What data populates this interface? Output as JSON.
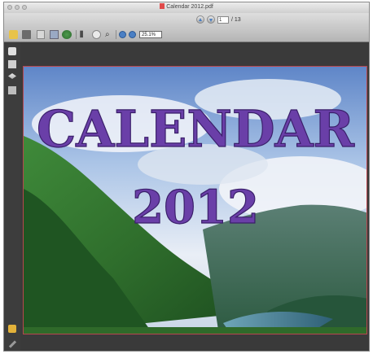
{
  "window": {
    "title": "Calendar 2012.pdf"
  },
  "navigation": {
    "current_page": "1",
    "page_total_label": "/ 13"
  },
  "toolbar": {
    "zoom_value": "25.1%"
  },
  "document": {
    "headline": "CALENDAR",
    "year": "2012"
  },
  "colors": {
    "headline_fill": "#6a3fa8",
    "page_border": "#b8474d"
  }
}
